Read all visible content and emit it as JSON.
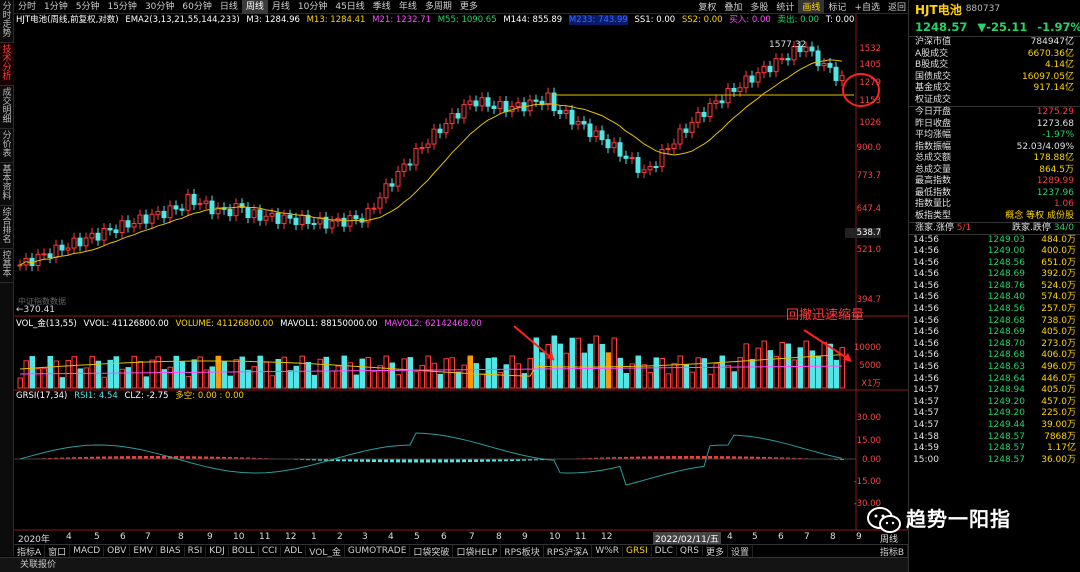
{
  "top_tabs": [
    "分时",
    "1分钟",
    "5分钟",
    "15分钟",
    "30分钟",
    "60分钟",
    "日线",
    "周线",
    "月线",
    "10分钟",
    "45日线",
    "季线",
    "年线",
    "多周期",
    "更多"
  ],
  "top_active": "周线",
  "top_right_tabs": [
    "复权",
    "叠加",
    "多股",
    "统计",
    "画线",
    "标记",
    "+自选",
    "返回"
  ],
  "top_right_active": "画线",
  "left_tabs": [
    "分时走势",
    "技术分析",
    "成交明细",
    "分价表",
    "基本资料",
    "综合排名",
    "控基本"
  ],
  "indicator_line1": {
    "title": "HJT电池(周线,前复权,对数)",
    "ema": "EMA2(3,13,21,55,144,233)",
    "m3": "M3: 1284.96",
    "m13": "M13: 1284.41",
    "m21": "M21: 1232.71",
    "m55": "M55: 1090.65",
    "m144": "M144: 855.89",
    "m233": "M233: 743.99",
    "ss1": "SS1: 0.00",
    "ss2": "SS2: 0.00",
    "buy": "买入: 0.00",
    "sell": "卖出: 0.00",
    "t": "T: 0.00"
  },
  "price_axis": [
    "1532",
    "1405",
    "1279",
    "1153",
    "1026",
    "900.0",
    "773.7",
    "647.4",
    "521.0",
    "394.7"
  ],
  "price_axis_extra": "538.7",
  "chart_annotations": {
    "high": "1577.32",
    "low": "←370.41",
    "watermark_small": "中证指数数据"
  },
  "vol_line": {
    "title": "VOL_金(13,55)",
    "vvol": "VVOL: 41126800.00",
    "volume": "VOLUME: 41126800.00",
    "mavol1": "MAVOL1: 88150000.00",
    "mavol2": "MAVOL2: 62142468.00"
  },
  "vol_axis": [
    "10000",
    "5000"
  ],
  "vol_unit": "X1万",
  "vol_note": "回撤迅速缩量",
  "grsi_line": {
    "title": "GRSI(17,34)",
    "rsi1": "RSI1: 4.54",
    "clz": "CLZ: -2.75",
    "dk": "多空: 0.00 : 0.00"
  },
  "grsi_axis": [
    "30.00",
    "15.00",
    "0.00",
    "-15.00",
    "-30.00"
  ],
  "x_axis": [
    "2020年",
    "4",
    "5",
    "6",
    "7",
    "8",
    "9",
    "10",
    "11",
    "12",
    "1",
    "2",
    "3",
    "4",
    "5",
    "6",
    "7",
    "8",
    "9",
    "10",
    "11",
    "12",
    "2022/02/11/五",
    "4",
    "5",
    "6",
    "7",
    "8",
    "9"
  ],
  "x_right": "周线",
  "bottom_tabs": [
    "指标A",
    "窗口",
    "MACD",
    "OBV",
    "EMV",
    "BIAS",
    "RSI",
    "KDJ",
    "BOLL",
    "CCI",
    "ADL",
    "VOL_金",
    "GUMOTRADE",
    "口袋突破",
    "口袋HELP",
    "RPS板块",
    "RPS沪深A",
    "W%R",
    "GRSI",
    "DLC",
    "QRS",
    "更多",
    "设置"
  ],
  "bottom_active": "GRSI",
  "bottom_right": "指标B",
  "status": "关联报价",
  "right": {
    "name": "HJT电池",
    "code": "880737",
    "price": "1248.57",
    "change": "▼-25.11",
    "pct": "-1.97%",
    "stats": [
      {
        "k": "沪深市值",
        "v": "784947亿",
        "c": "#e0e0e0"
      },
      {
        "k": "A股成交",
        "v": "6670.36亿",
        "c": "#ffd400"
      },
      {
        "k": "B股成交",
        "v": "4.14亿",
        "c": "#ffd400"
      },
      {
        "k": "国债成交",
        "v": "16097.05亿",
        "c": "#ffd400"
      },
      {
        "k": "基金成交",
        "v": "917.14亿",
        "c": "#ffd400"
      },
      {
        "k": "权证成交",
        "v": "",
        "c": "#ffd400"
      }
    ],
    "stats2": [
      {
        "k": "今日开盘",
        "v": "1275.29",
        "c": "#ff3b3b"
      },
      {
        "k": "昨日收盘",
        "v": "1273.68",
        "c": "#e0e0e0"
      },
      {
        "k": "平均涨幅",
        "v": "-1.97%",
        "c": "#25d366"
      },
      {
        "k": "指数振幅",
        "v": "52.03/4.09%",
        "c": "#e0e0e0"
      },
      {
        "k": "总成交额",
        "v": "178.88亿",
        "c": "#ffd400"
      },
      {
        "k": "总成交量",
        "v": "864.5万",
        "c": "#ffd400"
      },
      {
        "k": "最高指数",
        "v": "1289.99",
        "c": "#ff3b3b"
      },
      {
        "k": "最低指数",
        "v": "1237.96",
        "c": "#25d366"
      },
      {
        "k": "指数量比",
        "v": "1.06",
        "c": "#ff3b3b"
      },
      {
        "k": "板指类型",
        "v": "概念 等权 成份股",
        "c": "#ffd400"
      }
    ],
    "updown": {
      "k1": "涨家.涨停",
      "v1": "5/1",
      "k2": "跌家.跌停",
      "v2": "34/0"
    },
    "ticks": [
      {
        "t": "14:56",
        "p": "1249.03",
        "v": "484.0万"
      },
      {
        "t": "14:56",
        "p": "1249.00",
        "v": "400.0万"
      },
      {
        "t": "14:56",
        "p": "1248.56",
        "v": "651.0万"
      },
      {
        "t": "14:56",
        "p": "1248.69",
        "v": "392.0万"
      },
      {
        "t": "14:56",
        "p": "1248.76",
        "v": "524.0万"
      },
      {
        "t": "14:56",
        "p": "1248.40",
        "v": "574.0万"
      },
      {
        "t": "14:56",
        "p": "1248.56",
        "v": "257.0万"
      },
      {
        "t": "14:56",
        "p": "1248.68",
        "v": "738.0万"
      },
      {
        "t": "14:56",
        "p": "1248.69",
        "v": "405.0万"
      },
      {
        "t": "14:56",
        "p": "1248.70",
        "v": "273.0万"
      },
      {
        "t": "14:56",
        "p": "1248.68",
        "v": "406.0万"
      },
      {
        "t": "14:56",
        "p": "1248.63",
        "v": "496.0万"
      },
      {
        "t": "14:56",
        "p": "1248.64",
        "v": "446.0万"
      },
      {
        "t": "14:57",
        "p": "1248.94",
        "v": "405.0万"
      },
      {
        "t": "14:57",
        "p": "1249.20",
        "v": "457.0万"
      },
      {
        "t": "14:57",
        "p": "1249.20",
        "v": "225.0万"
      },
      {
        "t": "14:57",
        "p": "1249.44",
        "v": "39.00万"
      },
      {
        "t": "14:58",
        "p": "1248.57",
        "v": "7868万"
      },
      {
        "t": "14:59",
        "p": "1248.57",
        "v": "1.17亿"
      },
      {
        "t": "15:00",
        "p": "1248.57",
        "v": "36.00万"
      }
    ]
  },
  "watermark": "趋势一阳指",
  "colors": {
    "up": "#ff3b3b",
    "down": "#53e6e6",
    "ma": "#e6c200",
    "axis": "#ff3b3b",
    "bg": "#000000"
  }
}
